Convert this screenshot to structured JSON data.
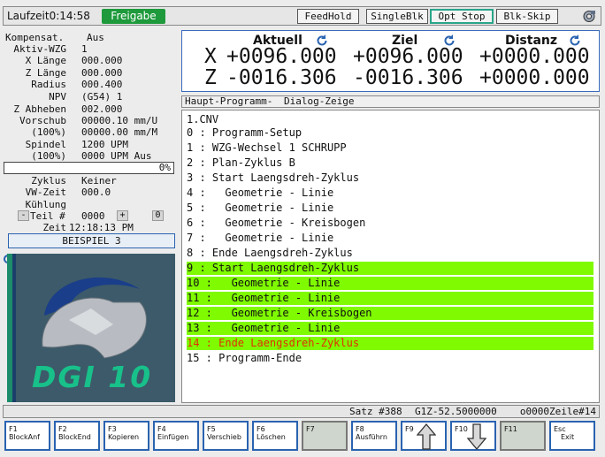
{
  "topbar": {
    "laufzeit": "Laufzeit0:14:58",
    "freigabe": "Freigabe",
    "buttons": [
      "FeedHold",
      "SingleBlk",
      "Opt Stop",
      "Blk-Skip"
    ]
  },
  "left": {
    "kompensat_label": "Kompensat.",
    "kompensat_value": "Aus",
    "rows": [
      {
        "label": "Aktiv-WZG",
        "value": "1"
      },
      {
        "label": "X Länge",
        "value": "000.000"
      },
      {
        "label": "Z Länge",
        "value": "000.000"
      },
      {
        "label": "Radius",
        "value": "000.400"
      },
      {
        "label": "NPV",
        "value": "(G54) 1"
      },
      {
        "label": "Z Abheben",
        "value": "002.000"
      },
      {
        "label": "Vorschub",
        "value": "00000.10 mm/U"
      },
      {
        "label": "(100%)",
        "value": "00000.00 mm/M"
      },
      {
        "label": "Spindel",
        "value": "1200 UPM"
      },
      {
        "label": "(100%)",
        "value": "0000 UPM Aus"
      }
    ],
    "progress_text": "0%",
    "progress": 0,
    "zyklus_label": "Zyklus",
    "zyklus_value": "Keiner",
    "vwzeit_label": "VW-Zeit",
    "vwzeit_value": "000.0",
    "kuehlung_label": "Kühlung",
    "teil_minus": "-",
    "teil_label": "Teil #",
    "teil_value": "0000",
    "teil_plus": "+",
    "teil_zero": "0",
    "zeit_label": "Zeit",
    "zeit_value": "12:18:13 PM",
    "program_name": "BEISPIEL 3",
    "logo_text": "DGI 10"
  },
  "coords": {
    "headers": [
      "Aktuell",
      "Ziel",
      "Distanz"
    ],
    "x": {
      "axis": "X",
      "aktuell": "+0096.000",
      "ziel": "+0096.000",
      "distanz": "+0000.000"
    },
    "z": {
      "axis": "Z",
      "aktuell": "-0016.306",
      "ziel": "-0016.306",
      "distanz": "+0000.000"
    }
  },
  "program": {
    "tab_main": "Haupt-Programm-",
    "tab_dialog": "Dialog-Zeige",
    "lines": [
      "1.CNV",
      "0 : Programm-Setup",
      "1 : WZG-Wechsel 1 SCHRUPP",
      "2 : Plan-Zyklus B",
      "3 : Start Laengsdreh-Zyklus",
      "4 :   Geometrie - Linie",
      "5 :   Geometrie - Linie",
      "6 :   Geometrie - Kreisbogen",
      "7 :   Geometrie - Linie",
      "8 : Ende Laengsdreh-Zyklus",
      "9 : Start Laengsdreh-Zyklus",
      "10 :   Geometrie - Linie",
      "11 :   Geometrie - Linie",
      "12 :   Geometrie - Kreisbogen",
      "13 :   Geometrie - Linie",
      "14 : Ende Laengsdreh-Zyklus",
      "15 : Programm-Ende"
    ]
  },
  "status": {
    "satz": "Satz #388",
    "g1z": "G1Z-52.5000000",
    "zeile": "o0000Zeile#14"
  },
  "fkeys": [
    {
      "key": "F1",
      "label": "BlockAnf"
    },
    {
      "key": "F2",
      "label": "BlockEnd"
    },
    {
      "key": "F3",
      "label": "Kopieren"
    },
    {
      "key": "F4",
      "label": "Einfügen"
    },
    {
      "key": "F5",
      "label": "Verschieb"
    },
    {
      "key": "F6",
      "label": "Löschen"
    },
    {
      "key": "F7",
      "label": ""
    },
    {
      "key": "F8",
      "label": "Ausführn"
    },
    {
      "key": "F9",
      "label": ""
    },
    {
      "key": "F10",
      "label": ""
    },
    {
      "key": "F11",
      "label": ""
    },
    {
      "key": "Esc",
      "label": "Exit"
    }
  ],
  "colors": {
    "accent": "#2a63b0",
    "highlight": "#7ffa00",
    "current_line": "#e03000",
    "freigabe": "#1e9a3c"
  }
}
